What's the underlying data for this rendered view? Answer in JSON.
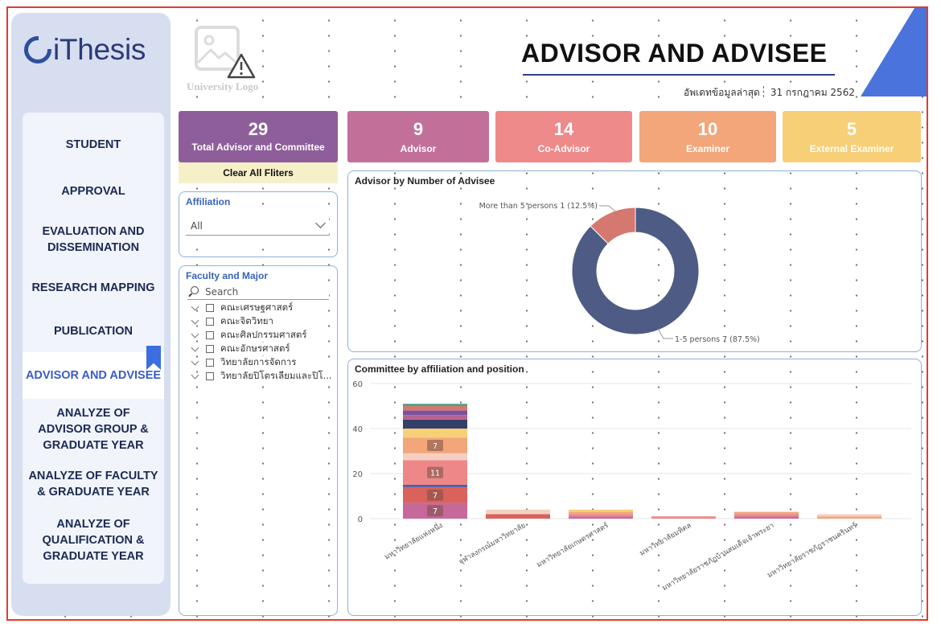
{
  "app": {
    "logo_text": "iThesis"
  },
  "sidebar": {
    "items": [
      {
        "label": "STUDENT"
      },
      {
        "label": "APPROVAL"
      },
      {
        "label": "EVALUATION AND DISSEMINATION"
      },
      {
        "label": "RESEARCH MAPPING"
      },
      {
        "label": "PUBLICATION"
      },
      {
        "label": "ADVISOR AND ADVISEE",
        "active": true
      },
      {
        "label": "ANALYZE OF ADVISOR GROUP & GRADUATE YEAR"
      },
      {
        "label": "ANALYZE OF FACULTY & GRADUATE YEAR"
      },
      {
        "label": "ANALYZE OF QUALIFICATION & GRADUATE YEAR"
      }
    ]
  },
  "header": {
    "university_logo_text": "University Logo",
    "university_logo_icon": "image-warning-icon",
    "title": "ADVISOR AND ADVISEE",
    "updated_label": "อัพเดทข้อมูลล่าสุด",
    "updated_date": "31 กรกฎาคม 2562",
    "accent_color": "#4a73dc"
  },
  "kpis": {
    "total": {
      "value": "29",
      "label": "Total Advisor and Committee",
      "color": "#8e5e9a"
    },
    "advisor": {
      "value": "9",
      "label": "Advisor",
      "color": "#c26f9a"
    },
    "co_advisor": {
      "value": "14",
      "label": "Co-Advisor",
      "color": "#ee8a89"
    },
    "examiner": {
      "value": "10",
      "label": "Examiner",
      "color": "#f2a67a"
    },
    "external_examiner": {
      "value": "5",
      "label": "External Examiner",
      "color": "#f6cf77"
    }
  },
  "filters": {
    "clear_label": "Clear All Fliters",
    "affiliation": {
      "title": "Affiliation",
      "value": "All"
    },
    "faculty": {
      "title": "Faculty and Major",
      "search_placeholder": "Search",
      "items": [
        "คณะเศรษฐศาสตร์",
        "คณะจิตวิทยา",
        "คณะศิลปกรรมศาสตร์",
        "คณะอักษรศาสตร์",
        "วิทยาลัยการจัดการ",
        "วิทยาลัยปิโตรเลียมและปิโ..."
      ]
    }
  },
  "donut": {
    "title": "Advisor by Number of Advisee",
    "slices": [
      {
        "label": "1-5 persons 7 (87.5%)",
        "value": 7,
        "color": "#4e5b85"
      },
      {
        "label": "More than 5 persons 1 (12.5%)",
        "value": 1,
        "color": "#d5786f"
      }
    ]
  },
  "chart_data": {
    "type": "bar",
    "title": "Committee by affiliation and position",
    "ylim": [
      0,
      60
    ],
    "yticks": [
      0,
      20,
      40,
      60
    ],
    "categories": [
      "มหาวิทยาลัยแห่งหนึ่ง",
      "จุฬาลงกรณ์มหาวิทยาลัย",
      "มหาวิทยาลัยเกษตรศาสตร์",
      "มหาวิทยาลัยมหิดล",
      "มหาวิทยาลัยราชภัฏบ้านสมเด็จเจ้าพระยา",
      "มหาวิทยาลัยราชภัฏราชนครินทร์"
    ],
    "segments": [
      [
        {
          "value": 7,
          "color": "#c7689a",
          "label": "7"
        },
        {
          "value": 7,
          "color": "#d9625b",
          "label": "7"
        },
        {
          "value": 1,
          "color": "#3f5fae"
        },
        {
          "value": 11,
          "color": "#ee8888",
          "label": "11"
        },
        {
          "value": 3,
          "color": "#f5d0c2"
        },
        {
          "value": 7,
          "color": "#f2a67a",
          "label": "7"
        },
        {
          "value": 4,
          "color": "#f6cf77"
        },
        {
          "value": 4,
          "color": "#343f6a"
        },
        {
          "value": 2,
          "color": "#b7658f"
        },
        {
          "value": 2,
          "color": "#7a52a0"
        },
        {
          "value": 2,
          "color": "#d5786f"
        },
        {
          "value": 1,
          "color": "#4fa08a"
        }
      ],
      [
        {
          "value": 2,
          "color": "#d9625b"
        },
        {
          "value": 2,
          "color": "#f5d0c2"
        }
      ],
      [
        {
          "value": 1,
          "color": "#c7689a"
        },
        {
          "value": 1,
          "color": "#ee8888"
        },
        {
          "value": 1,
          "color": "#f2a67a"
        },
        {
          "value": 1,
          "color": "#f6cf77"
        }
      ],
      [
        {
          "value": 1,
          "color": "#ee8888"
        }
      ],
      [
        {
          "value": 1,
          "color": "#c7689a"
        },
        {
          "value": 1,
          "color": "#ee8888"
        },
        {
          "value": 1,
          "color": "#f2a67a"
        }
      ],
      [
        {
          "value": 1,
          "color": "#f2a67a"
        },
        {
          "value": 1,
          "color": "#f5d0c2"
        }
      ]
    ]
  }
}
